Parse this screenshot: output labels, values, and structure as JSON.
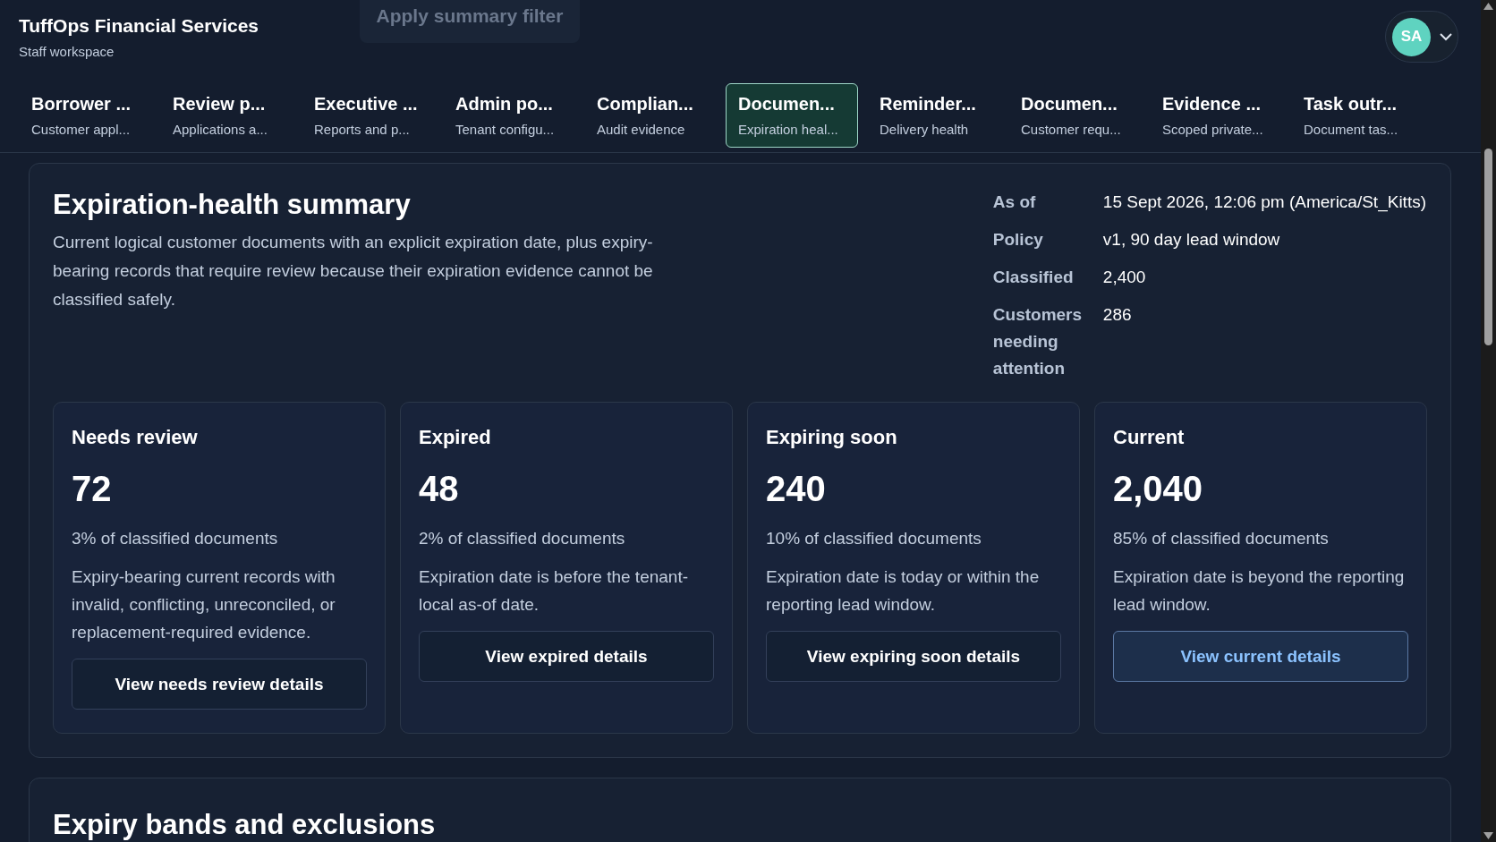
{
  "header": {
    "title": "TuffOps Financial Services",
    "subtitle": "Staff workspace",
    "ghost_button": "Apply summary filter",
    "avatar": "SA"
  },
  "tabs": [
    {
      "title": "Borrower ...",
      "subtitle": "Customer appl...",
      "selected": false
    },
    {
      "title": "Review p...",
      "subtitle": "Applications a...",
      "selected": false
    },
    {
      "title": "Executive ...",
      "subtitle": "Reports and p...",
      "selected": false
    },
    {
      "title": "Admin po...",
      "subtitle": "Tenant configu...",
      "selected": false
    },
    {
      "title": "Complian...",
      "subtitle": "Audit evidence",
      "selected": false
    },
    {
      "title": "Documen...",
      "subtitle": "Expiration heal...",
      "selected": true
    },
    {
      "title": "Reminder...",
      "subtitle": "Delivery health",
      "selected": false
    },
    {
      "title": "Documen...",
      "subtitle": "Customer requ...",
      "selected": false
    },
    {
      "title": "Evidence ...",
      "subtitle": "Scoped private...",
      "selected": false
    },
    {
      "title": "Task outr...",
      "subtitle": "Document tas...",
      "selected": false
    }
  ],
  "summary": {
    "title": "Expiration-health summary",
    "description": "Current logical customer documents with an explicit expiration date, plus expiry-bearing records that require review because their expiration evidence cannot be classified safely.",
    "meta": [
      {
        "label": "As of",
        "value": "15 Sept 2026, 12:06 pm (America/St_Kitts)"
      },
      {
        "label": "Policy",
        "value": "v1, 90 day lead window"
      },
      {
        "label": "Classified",
        "value": "2,400"
      },
      {
        "label": "Customers needing attention",
        "value": "286"
      }
    ],
    "cards": [
      {
        "title": "Needs review",
        "count": "72",
        "share": "3% of classified documents",
        "text": "Expiry-bearing current records with invalid, conflicting, unreconciled, or replacement-required evidence.",
        "button": "View needs review details",
        "focused": false
      },
      {
        "title": "Expired",
        "count": "48",
        "share": "2% of classified documents",
        "text": "Expiration date is before the tenant-local as-of date.",
        "button": "View expired details",
        "focused": false
      },
      {
        "title": "Expiring soon",
        "count": "240",
        "share": "10% of classified documents",
        "text": "Expiration date is today or within the reporting lead window.",
        "button": "View expiring soon details",
        "focused": false
      },
      {
        "title": "Current",
        "count": "2,040",
        "share": "85% of classified documents",
        "text": "Expiration date is beyond the reporting lead window.",
        "button": "View current details",
        "focused": true
      }
    ]
  },
  "bands": {
    "title": "Expiry bands and exclusions"
  }
}
